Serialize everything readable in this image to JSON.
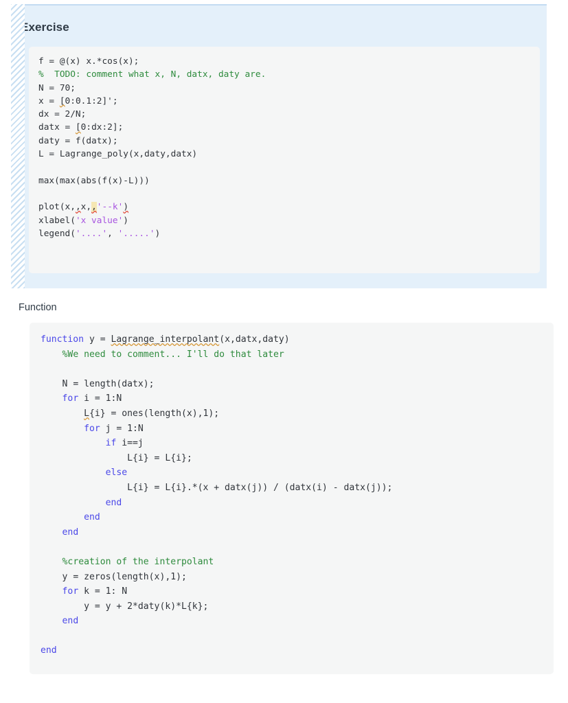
{
  "theme": {
    "panel_bg": "#e4f0fa",
    "panel_border": "#c3dcf2",
    "code_bg": "#f5f6f6",
    "comment_color": "#2e8b3d",
    "keyword_color": "#4a47e8",
    "string_color": "#a855e0",
    "text_color": "#30343a",
    "spell_underline_color": "#d79a3c",
    "error_underline_color": "#e04a3a",
    "highlight_color": "#f6e7b4"
  },
  "exercise": {
    "title": "Exercise",
    "code_lines": [
      "f = @(x) x.*cos(x);",
      "%  TODO: comment what x, N, datx, daty are.",
      "N = 70;",
      "x = [0:0.1:2]';",
      "dx = 2/N;",
      "datx = [0:dx:2];",
      "daty = f(datx);",
      "L = Lagrange_poly(x,daty,datx)",
      "",
      "max(max(abs(f(x)-L)))",
      "",
      "plot(x,,x,,'--k')",
      "xlabel('x value')",
      "legend('....', '.....')"
    ]
  },
  "function_section": {
    "label": "Function",
    "code_lines": [
      "function y = Lagrange_interpolant(x,datx,daty)",
      "    %We need to comment... I'll do that later",
      "",
      "    N = length(datx);",
      "    for i = 1:N",
      "        L{i} = ones(length(x),1);",
      "        for j = 1:N",
      "            if i==j",
      "                L{i} = L{i};",
      "            else",
      "                L{i} = L{i}.*(x + datx(j)) / (datx(i) - datx(j));",
      "            end",
      "        end",
      "    end",
      "",
      "    %creation of the interpolant",
      "    y = zeros(length(x),1);",
      "    for k = 1: N",
      "        y = y + 2*daty(k)*L{k};",
      "    end",
      "",
      "end"
    ]
  }
}
